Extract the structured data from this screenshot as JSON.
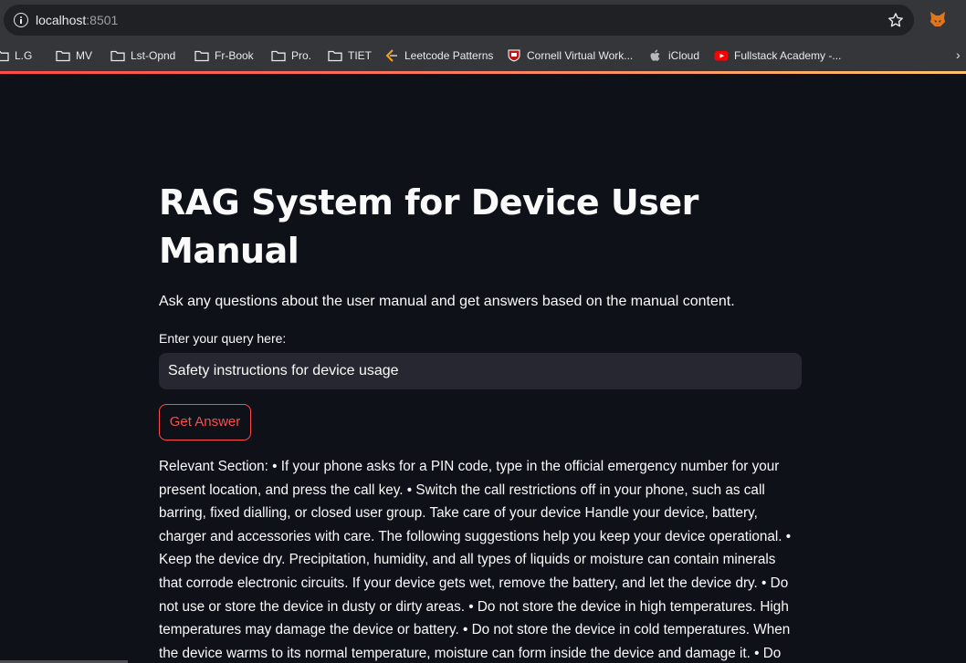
{
  "browser": {
    "url_host": "localhost",
    "url_port": ":8501",
    "bookmarks": [
      {
        "label": "L.G",
        "icon": "folder-icon"
      },
      {
        "label": "MV",
        "icon": "folder-icon"
      },
      {
        "label": "Lst-Opnd",
        "icon": "folder-icon"
      },
      {
        "label": "Fr-Book",
        "icon": "folder-icon"
      },
      {
        "label": "Pro.",
        "icon": "folder-icon"
      },
      {
        "label": "TIET",
        "icon": "folder-icon"
      },
      {
        "label": "Leetcode Patterns",
        "icon": "leetcode-icon"
      },
      {
        "label": "Cornell Virtual Work...",
        "icon": "cornell-icon"
      },
      {
        "label": "iCloud",
        "icon": "apple-icon"
      },
      {
        "label": "Fullstack Academy -...",
        "icon": "youtube-icon"
      }
    ],
    "more_label": "›"
  },
  "app": {
    "title": "RAG System for Device User Manual",
    "subtitle": "Ask any questions about the user manual and get answers based on the manual content.",
    "query_label": "Enter your query here:",
    "query_value": "Safety instructions for device usage",
    "button_label": "Get Answer",
    "answer": "Relevant Section: • If your phone asks for a PIN code, type in the official emergency number for your present location, and press the call key. • Switch the call restrictions off in your phone, such as call barring, fixed dialling, or closed user group. Take care of your device Handle your device, battery, charger and accessories with care. The following suggestions help you keep your device operational. • Keep the device dry. Precipitation, humidity, and all types of liquids or moisture can contain minerals that corrode electronic circuits. If your device gets wet, remove the battery, and let the device dry. • Do not use or store the device in dusty or dirty areas. • Do not store the device in high temperatures. High temperatures may damage the device or battery. • Do not store the device in cold temperatures. When the device warms to its normal temperature, moisture can form inside the device and damage it. • Do not open the device"
  },
  "colors": {
    "background": "#0e1117",
    "input_bg": "#262730",
    "accent": "#ff4b4b",
    "text": "#fafafa"
  }
}
